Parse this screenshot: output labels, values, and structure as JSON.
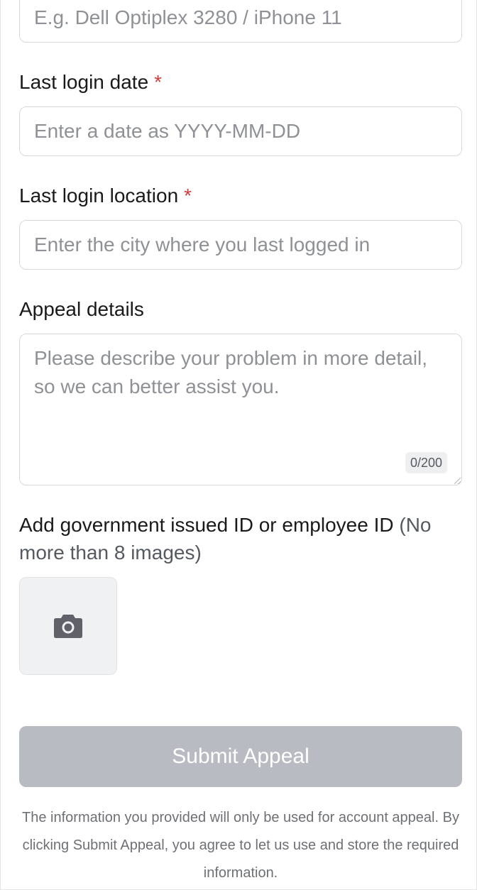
{
  "device_model": {
    "placeholder": "E.g. Dell Optiplex 3280 / iPhone 11"
  },
  "last_login_date": {
    "label": "Last login date",
    "required_mark": "*",
    "placeholder": "Enter a date as YYYY-MM-DD"
  },
  "last_login_location": {
    "label": "Last login location",
    "required_mark": "*",
    "placeholder": "Enter the city where you last logged in"
  },
  "appeal_details": {
    "label": "Appeal details",
    "placeholder": "Please describe your problem in more detail, so we can better assist you.",
    "counter": "0/200"
  },
  "id_upload": {
    "label": "Add government issued ID or employee ID",
    "hint": "(No more than 8 images)",
    "icon": "camera-icon"
  },
  "submit": {
    "label": "Submit Appeal"
  },
  "disclaimer": "The information you provided will only be used for account appeal. By clicking Submit Appeal, you agree to let us use and store the required information.",
  "colors": {
    "required": "#d23c3c",
    "button_disabled": "#b8bbc1",
    "border": "#d6d8dc"
  }
}
